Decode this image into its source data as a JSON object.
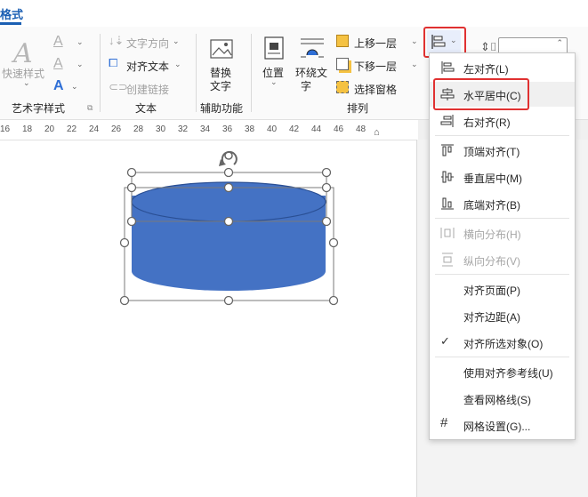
{
  "tab": {
    "label": "格式"
  },
  "ribbon": {
    "art_text_group": {
      "label": "艺术字样式",
      "quick_styles": "快速样式"
    },
    "text_group": {
      "label": "文本",
      "text_direction": "文字方向",
      "align_text": "对齐文本",
      "create_link": "创建链接"
    },
    "accessibility_group": {
      "label": "辅助功能",
      "alt_text_line1": "替换",
      "alt_text_line2": "文字"
    },
    "arrange_group": {
      "label": "排列",
      "position": "位置",
      "wrap_text_line1": "环绕文",
      "wrap_text_line2": "字",
      "bring_forward": "上移一层",
      "send_backward": "下移一层",
      "selection_pane": "选择窗格"
    }
  },
  "ruler": {
    "ticks": [
      "16",
      "18",
      "20",
      "22",
      "24",
      "26",
      "28",
      "30",
      "32",
      "34",
      "36",
      "38",
      "40",
      "42",
      "44",
      "46",
      "48"
    ]
  },
  "align_menu": {
    "items": [
      {
        "label": "左对齐(L)",
        "icon": "align-left-icon",
        "disabled": false
      },
      {
        "label": "水平居中(C)",
        "icon": "align-center-icon",
        "disabled": false,
        "highlighted": true
      },
      {
        "label": "右对齐(R)",
        "icon": "align-right-icon",
        "disabled": false
      },
      {
        "label": "顶端对齐(T)",
        "icon": "align-top-icon",
        "disabled": false
      },
      {
        "label": "垂直居中(M)",
        "icon": "align-middle-icon",
        "disabled": false
      },
      {
        "label": "底端对齐(B)",
        "icon": "align-bottom-icon",
        "disabled": false
      },
      {
        "label": "横向分布(H)",
        "icon": "distribute-horizontal-icon",
        "disabled": true
      },
      {
        "label": "纵向分布(V)",
        "icon": "distribute-vertical-icon",
        "disabled": true
      },
      {
        "label": "对齐页面(P)",
        "icon": "",
        "disabled": false
      },
      {
        "label": "对齐边距(A)",
        "icon": "",
        "disabled": false
      },
      {
        "label": "对齐所选对象(O)",
        "icon": "check-icon",
        "disabled": false,
        "checked": true
      },
      {
        "label": "使用对齐参考线(U)",
        "icon": "",
        "disabled": false
      },
      {
        "label": "查看网格线(S)",
        "icon": "",
        "disabled": false
      },
      {
        "label": "网格设置(G)...",
        "icon": "grid-icon",
        "disabled": false
      }
    ]
  },
  "colors": {
    "accent": "#1b5fb3",
    "shape_fill": "#4472c4",
    "highlight_box": "#e03131"
  }
}
